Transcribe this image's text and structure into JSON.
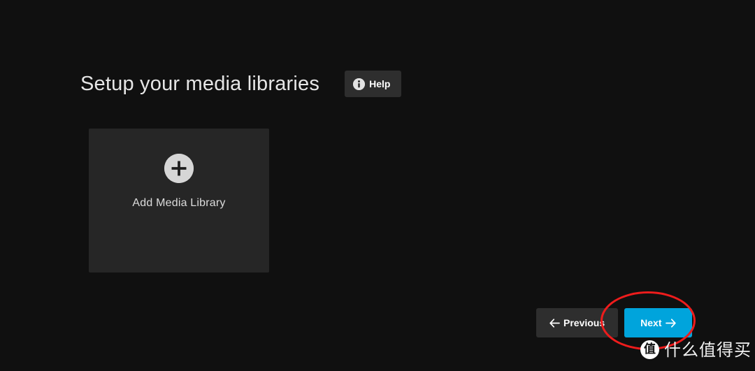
{
  "page": {
    "background_color": "#101010",
    "title": "Setup your media libraries"
  },
  "header": {
    "title": "Setup your media libraries",
    "help_button": {
      "label": "Help",
      "icon": "info-circle-icon",
      "background_color": "#2e2e2e"
    }
  },
  "main": {
    "library_cards": [
      {
        "label": "Add Media Library",
        "icon": "plus-circle-icon",
        "background_color": "#262626"
      }
    ]
  },
  "footer": {
    "previous_button": {
      "label": "Previous",
      "icon": "arrow-left-icon",
      "background_color": "#2e2e2e"
    },
    "next_button": {
      "label": "Next",
      "icon": "arrow-right-icon",
      "background_color": "#00a4dc"
    }
  },
  "annotation": {
    "shape": "ellipse",
    "color": "#ee1c1c",
    "target": "next-button"
  },
  "watermark": {
    "logo_char": "值",
    "text": "什么值得买"
  }
}
